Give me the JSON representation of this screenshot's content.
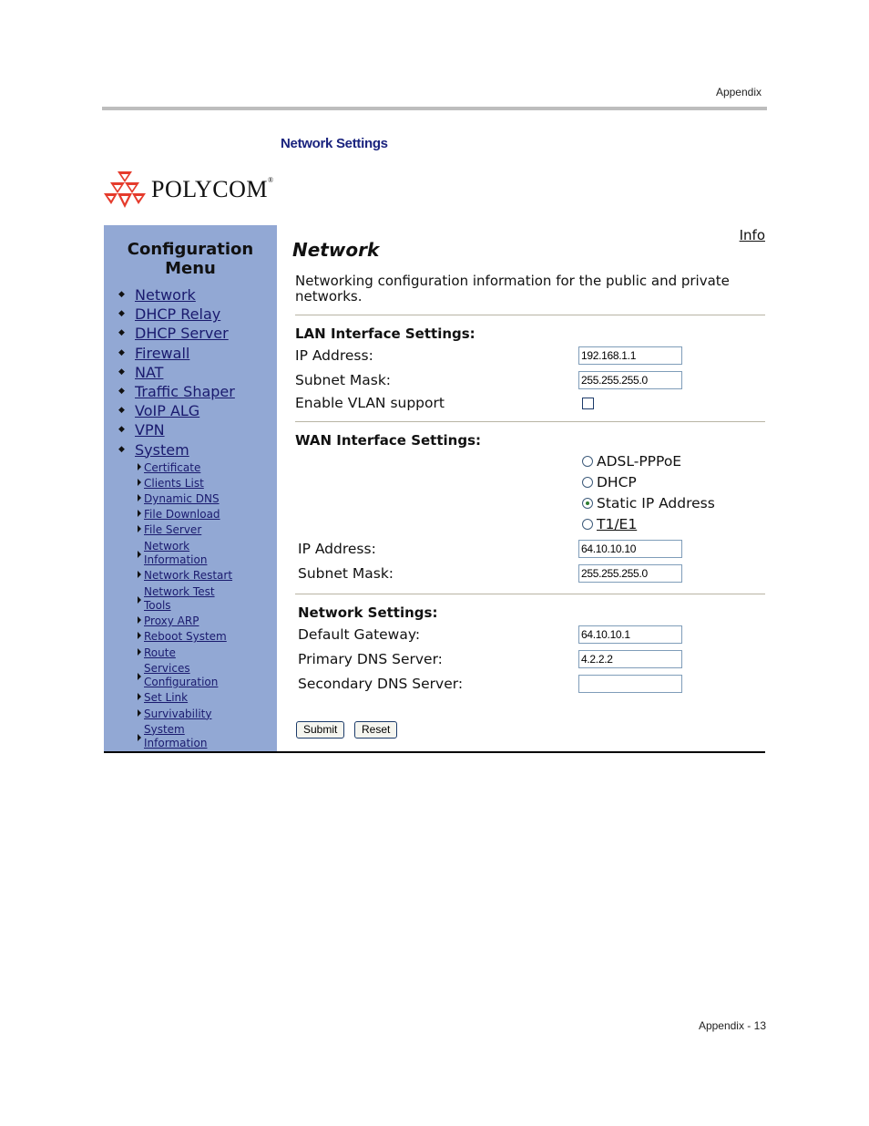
{
  "page": {
    "running_head": "Appendix",
    "figure_title": "Network Settings",
    "folio": "Appendix - 13"
  },
  "logo": {
    "text": "POLYCOM",
    "mark": "®",
    "color": "#e53b2c"
  },
  "sidebar": {
    "title_line1": "Configuration",
    "title_line2": "Menu",
    "items": [
      {
        "label": "Network"
      },
      {
        "label": "DHCP Relay"
      },
      {
        "label": "DHCP Server"
      },
      {
        "label": "Firewall"
      },
      {
        "label": "NAT"
      },
      {
        "label": "Traffic Shaper"
      },
      {
        "label": "VoIP ALG"
      },
      {
        "label": "VPN"
      },
      {
        "label": "System"
      }
    ],
    "system_items": [
      {
        "label": "Certificate"
      },
      {
        "label": "Clients List"
      },
      {
        "label": "Dynamic DNS"
      },
      {
        "label": "File Download"
      },
      {
        "label": "File Server"
      },
      {
        "line1": "Network",
        "line2": "Information"
      },
      {
        "label": "Network Restart"
      },
      {
        "line1": "Network Test",
        "line2": "Tools"
      },
      {
        "label": "Proxy ARP"
      },
      {
        "label": "Reboot System"
      },
      {
        "label": "Route"
      },
      {
        "line1": "Services",
        "line2": "Configuration"
      },
      {
        "label": "Set Link"
      },
      {
        "label": "Survivability"
      },
      {
        "line1": "System",
        "line2": "Information"
      }
    ]
  },
  "main": {
    "info_link": "Info",
    "heading": "Network",
    "description": "Networking configuration information for the public and private networks.",
    "lan": {
      "heading": "LAN Interface Settings:",
      "ip_label": "IP Address:",
      "ip_value": "192.168.1.1",
      "mask_label": "Subnet Mask:",
      "mask_value": "255.255.255.0",
      "vlan_label": "Enable VLAN support",
      "vlan_checked": false
    },
    "wan": {
      "heading": "WAN Interface Settings:",
      "modes": [
        {
          "label": "ADSL-PPPoE",
          "selected": false
        },
        {
          "label": "DHCP",
          "selected": false
        },
        {
          "label": "Static IP Address",
          "selected": true
        },
        {
          "label": "T1/E1",
          "selected": false
        }
      ],
      "ip_label": "IP Address:",
      "ip_value": "64.10.10.10",
      "mask_label": "Subnet Mask:",
      "mask_value": "255.255.255.0"
    },
    "net": {
      "heading": "Network Settings:",
      "gateway_label": "Default Gateway:",
      "gateway_value": "64.10.10.1",
      "dns1_label": "Primary DNS Server:",
      "dns1_value": "4.2.2.2",
      "dns2_label": "Secondary DNS Server:",
      "dns2_value": ""
    },
    "buttons": {
      "submit": "Submit",
      "reset": "Reset"
    }
  }
}
